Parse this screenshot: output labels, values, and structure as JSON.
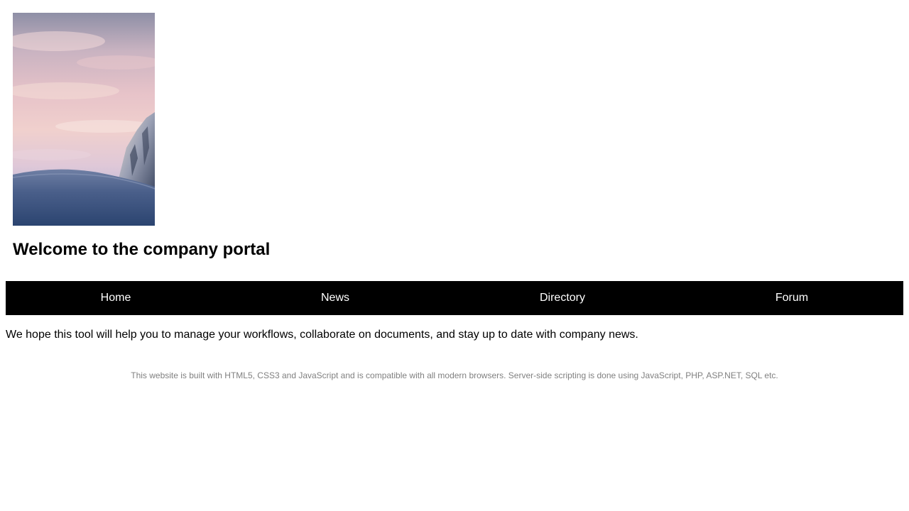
{
  "header": {
    "image_name": "mountain-sunset-image"
  },
  "page": {
    "title": "Welcome to the company portal",
    "intro": "We hope this tool will help you to manage your workflows, collaborate on documents, and stay up to date with company news.",
    "footer": "This website is built with HTML5, CSS3 and JavaScript and is compatible with all modern browsers. Server-side scripting is done using JavaScript, PHP, ASP.NET, SQL etc."
  },
  "nav": {
    "items": [
      {
        "label": "Home"
      },
      {
        "label": "News"
      },
      {
        "label": "Directory"
      },
      {
        "label": "Forum"
      }
    ]
  },
  "colors": {
    "nav_background": "#000000",
    "nav_text": "#ffffff",
    "footer_text": "#808080"
  }
}
